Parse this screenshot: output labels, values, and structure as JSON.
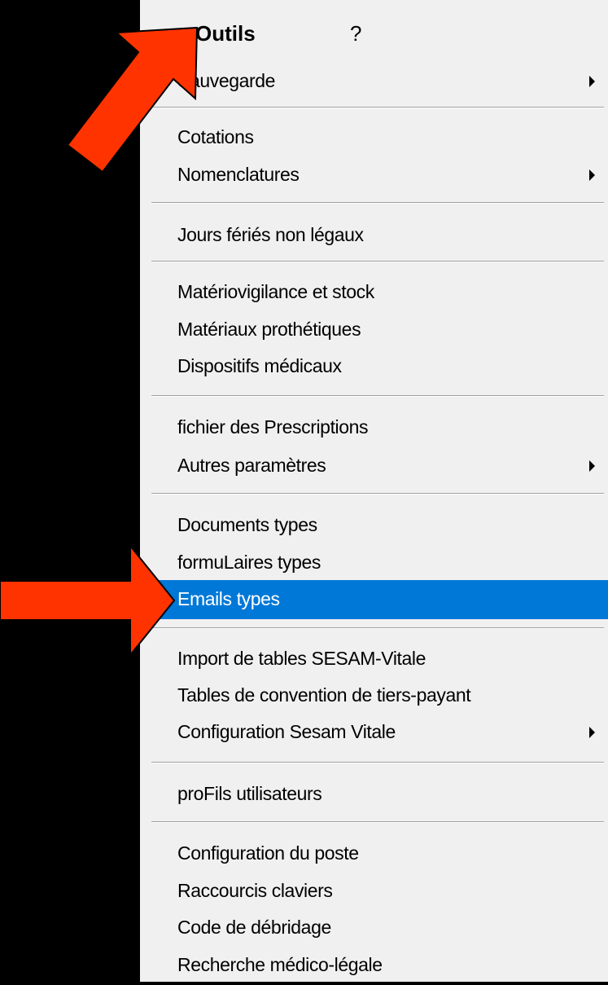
{
  "menubar": {
    "outils": "Outils",
    "help": "?"
  },
  "items": [
    {
      "label": "Sauvegarde",
      "submenu": true
    },
    {
      "label": "Cotations",
      "submenu": false
    },
    {
      "label": "Nomenclatures",
      "submenu": true
    },
    {
      "label": "Jours fériés non légaux",
      "submenu": false
    },
    {
      "label": "Matériovigilance et stock",
      "submenu": false
    },
    {
      "label": "Matériaux prothétiques",
      "submenu": false
    },
    {
      "label": "Dispositifs médicaux",
      "submenu": false
    },
    {
      "label": "fichier des Prescriptions",
      "submenu": false
    },
    {
      "label": "Autres paramètres",
      "submenu": true
    },
    {
      "label": "Documents types",
      "submenu": false
    },
    {
      "label": "formuLaires types",
      "submenu": false
    },
    {
      "label": "Emails types",
      "submenu": false,
      "selected": true
    },
    {
      "label": "Import de tables SESAM-Vitale",
      "submenu": false
    },
    {
      "label": "Tables de convention de tiers-payant",
      "submenu": false
    },
    {
      "label": "Configuration Sesam Vitale",
      "submenu": true
    },
    {
      "label": "proFils utilisateurs",
      "submenu": false
    },
    {
      "label": "Configuration du poste",
      "submenu": false
    },
    {
      "label": "Raccourcis claviers",
      "submenu": false
    },
    {
      "label": "Code de débridage",
      "submenu": false
    },
    {
      "label": "Recherche médico-légale",
      "submenu": false
    }
  ],
  "colors": {
    "highlight": "#0078d7",
    "annotation_arrow": "#ff3300",
    "menu_bg": "#f0f0f0"
  },
  "icons": {
    "submenu": "submenu-arrow-icon",
    "annotation": "red-arrow-icon"
  }
}
